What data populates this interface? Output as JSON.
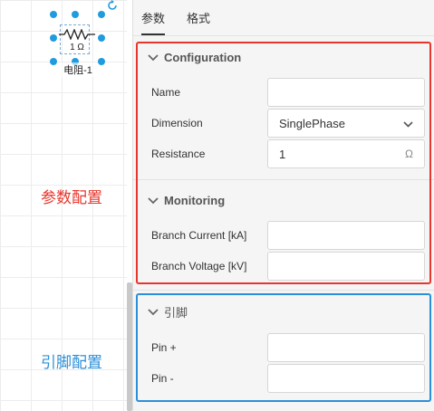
{
  "canvas": {
    "component": {
      "value_label": "1 Ω",
      "name_label": "电阻-1"
    },
    "annotations": {
      "param_config": "参数配置",
      "pin_config": "引脚配置"
    }
  },
  "panel": {
    "tabs": [
      {
        "label": "参数",
        "active": true
      },
      {
        "label": "格式",
        "active": false
      }
    ],
    "configuration": {
      "title": "Configuration",
      "name_label": "Name",
      "name_value": "",
      "dimension_label": "Dimension",
      "dimension_value": "SinglePhase",
      "resistance_label": "Resistance",
      "resistance_value": "1",
      "resistance_unit": "Ω"
    },
    "monitoring": {
      "title": "Monitoring",
      "branch_current_label": "Branch Current [kA]",
      "branch_current_value": "",
      "branch_voltage_label": "Branch Voltage [kV]",
      "branch_voltage_value": ""
    },
    "pins": {
      "title": "引脚",
      "pin_plus_label": "Pin +",
      "pin_plus_value": "",
      "pin_minus_label": "Pin -",
      "pin_minus_value": ""
    }
  },
  "colors": {
    "selection_blue": "#1f9bde",
    "highlight_red": "#e8362c",
    "highlight_blue": "#2b8fd8"
  },
  "icons": [
    "rotate-icon",
    "resistor-symbol-icon",
    "chevron-down-icon"
  ]
}
